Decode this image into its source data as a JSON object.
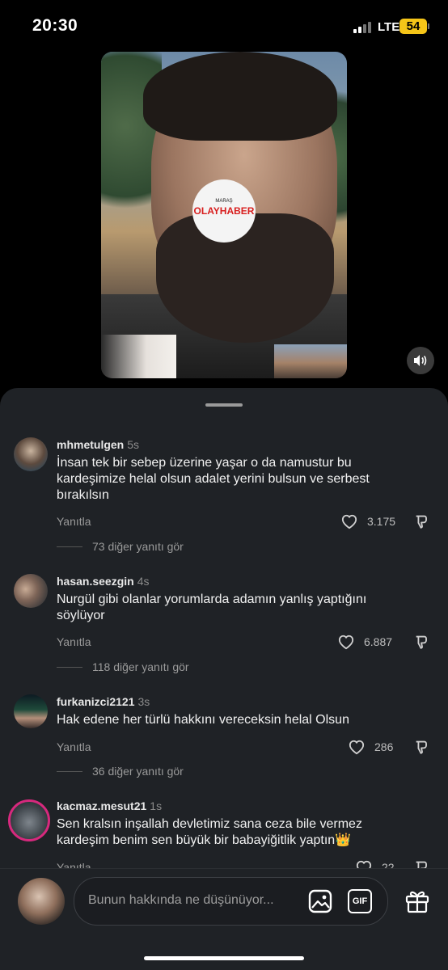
{
  "status_bar": {
    "time": "20:30",
    "network": "LTE",
    "battery": "54"
  },
  "video": {
    "logo_line1": "MARAŞ",
    "logo_line2": "OLAYHABER",
    "icons": {
      "sound": "speaker-icon"
    }
  },
  "comments": [
    {
      "username": "mhmetulgen",
      "time": "5s",
      "text_lines": [
        "İnsan tek bir sebep üzerine yaşar o da namustur bu",
        "kardeşimize helal olsun adalet yerini bulsun ve serbest",
        "bırakılsın"
      ],
      "reply_label": "Yanıtla",
      "likes": "3.175",
      "more_replies": "73 diğer yanıtı gör"
    },
    {
      "username": "hasan.seezgin",
      "time": "4s",
      "text_lines": [
        "Nurgül gibi olanlar yorumlarda adamın yanlış yaptığını",
        "söylüyor"
      ],
      "reply_label": "Yanıtla",
      "likes": "6.887",
      "more_replies": "118 diğer yanıtı gör"
    },
    {
      "username": "furkanizci2121",
      "time": "3s",
      "text_lines": [
        "Hak edene her türlü hakkını vereceksin helal Olsun"
      ],
      "reply_label": "Yanıtla",
      "likes": "286",
      "more_replies": "36 diğer yanıtı gör"
    },
    {
      "username": "kacmaz.mesut21",
      "time": "1s",
      "text_lines": [
        "Sen kralsın inşallah devletimiz sana ceza bile vermez",
        "kardeşim benim sen büyük bir babayiğitlik yaptın👑"
      ],
      "reply_label": "Yanıtla",
      "likes": "22"
    }
  ],
  "composer": {
    "placeholder": "Bunun hakkında ne düşünüyor...",
    "gif_label": "GIF"
  },
  "colors": {
    "sheet_bg": "#1f2226",
    "battery": "#f5c518",
    "logo_red": "#d81e1e"
  }
}
